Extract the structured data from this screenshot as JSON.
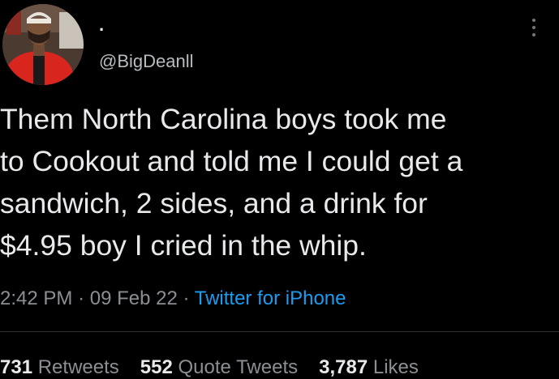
{
  "tweet": {
    "display_name": ".",
    "handle": "@BigDeanll",
    "text_lines": [
      "Them North Carolina boys took me",
      "to Cookout and told me I could get a",
      "sandwich, 2 sides, and a drink for",
      "$4.95 boy I cried in the whip."
    ],
    "time": "2:42 PM",
    "sep": "·",
    "date": "09 Feb 22",
    "source": "Twitter for iPhone"
  },
  "stats": {
    "retweets": {
      "count": "731",
      "label": "Retweets"
    },
    "quotes": {
      "count": "552",
      "label": "Quote Tweets"
    },
    "likes": {
      "count": "3,787",
      "label": "Likes"
    }
  },
  "icons": {
    "avatar": "profile-photo",
    "more": "more-vertical-icon"
  },
  "colors": {
    "background": "#000000",
    "text": "#e7e9ea",
    "secondary": "#8b8f93",
    "link": "#1d9bf0"
  }
}
